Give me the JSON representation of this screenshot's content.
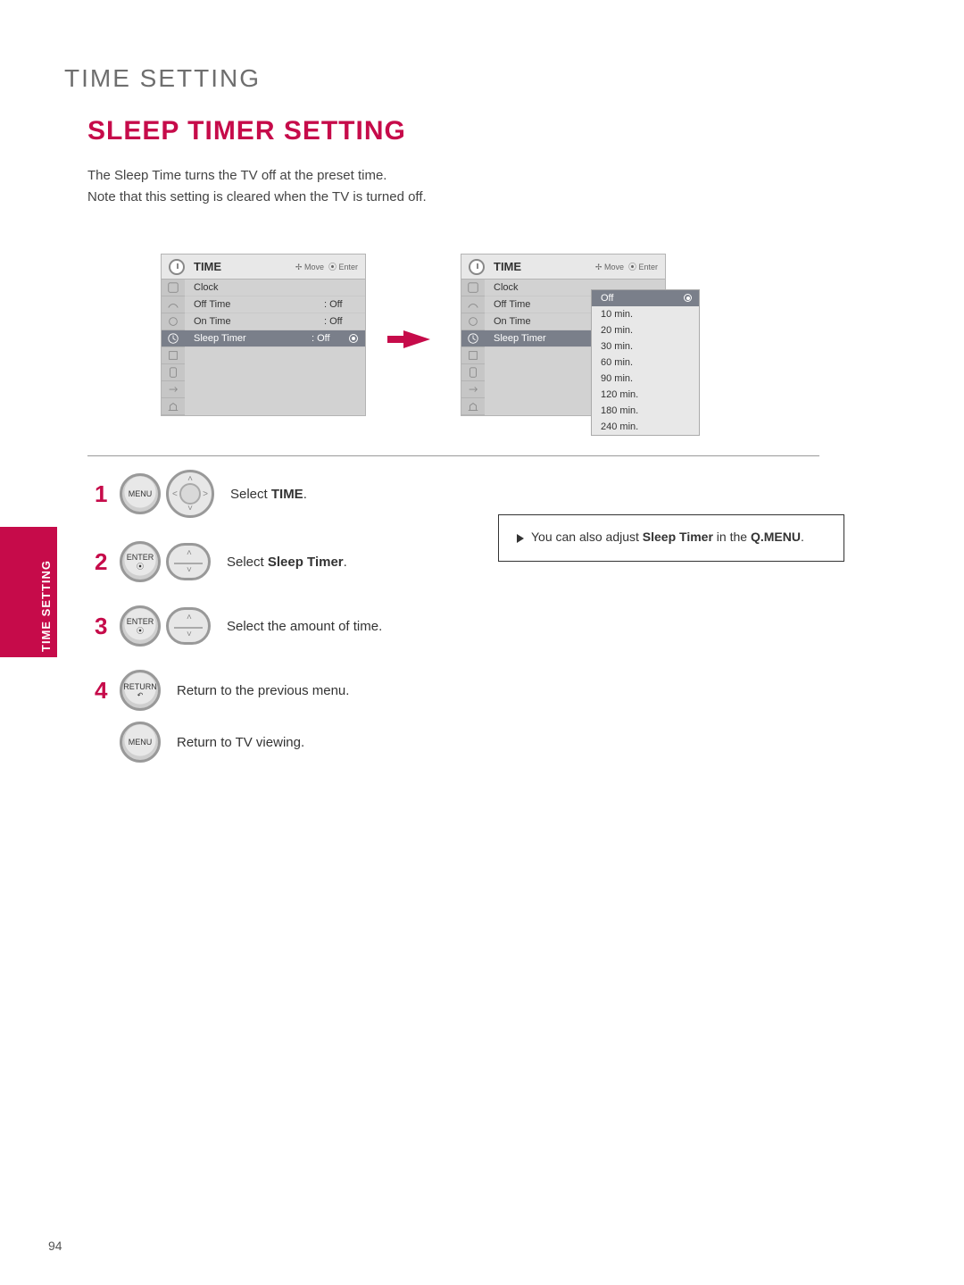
{
  "page": {
    "header": "TIME SETTING",
    "section_title": "SLEEP TIMER SETTING",
    "intro_line1": "The Sleep Time turns the TV off at the preset time.",
    "intro_line2": "Note that this setting is cleared when the TV is turned off.",
    "page_number": "94"
  },
  "osd": {
    "title": "TIME",
    "hint_move": "Move",
    "hint_enter": "Enter",
    "rows": [
      {
        "label": "Clock",
        "val": ""
      },
      {
        "label": "Off Time",
        "val": ": Off"
      },
      {
        "label": "On Time",
        "val": ": Off"
      },
      {
        "label": "Sleep Timer",
        "val": ": Off"
      }
    ]
  },
  "submenu": {
    "items": [
      "Off",
      "10 min.",
      "20 min.",
      "30 min.",
      "60 min.",
      "90 min.",
      "120 min.",
      "180 min.",
      "240 min."
    ]
  },
  "steps": {
    "s1": {
      "num": "1",
      "btn": "MENU",
      "text_pre": "Select ",
      "text_b": "TIME",
      "text_post": "."
    },
    "s2": {
      "num": "2",
      "btn": "ENTER",
      "text_pre": "Select ",
      "text_b": "Sleep Timer",
      "text_post": "."
    },
    "s3": {
      "num": "3",
      "btn": "ENTER",
      "text_pre": "Select the amount of time.",
      "text_b": "",
      "text_post": ""
    },
    "s4": {
      "num": "4",
      "btn": "RETURN",
      "text_pre": "Return to the previous menu.",
      "text_b": "",
      "text_post": ""
    },
    "s5": {
      "num": "",
      "btn": "MENU",
      "text_pre": "Return to TV viewing.",
      "text_b": "",
      "text_post": ""
    }
  },
  "note": {
    "line1_pre": "You can also adjust ",
    "line1_b1": "Sleep Timer",
    "line1_mid": " in the ",
    "line1_b2": "Q.MENU",
    "line1_post": "."
  },
  "sidetab": "TIME SETTING"
}
